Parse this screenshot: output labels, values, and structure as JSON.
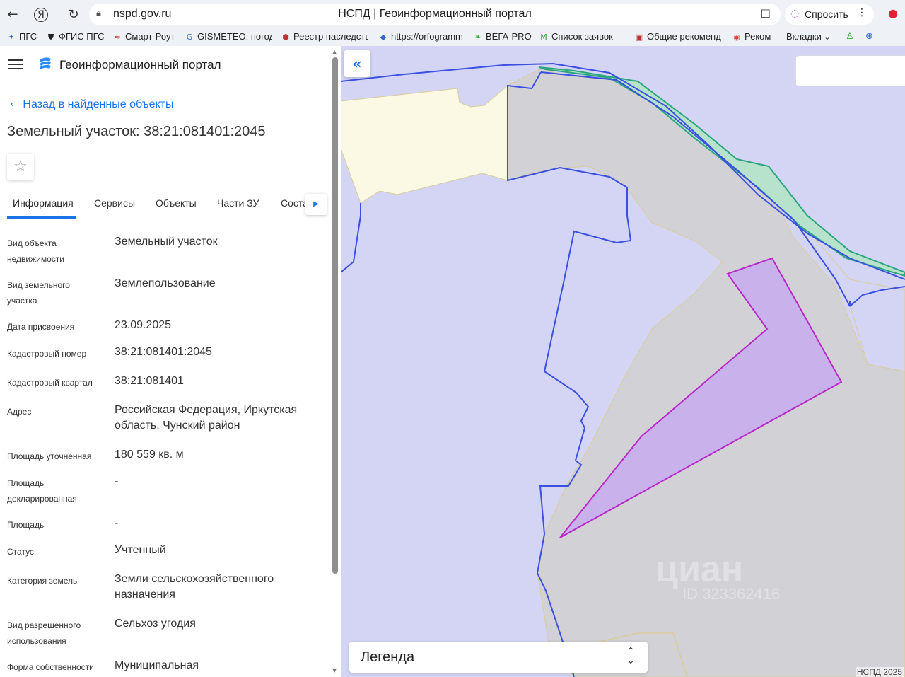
{
  "browser": {
    "url": "nspd.gov.ru",
    "tab_title": "НСПД | Геоинформационный портал",
    "ask_button": "Спросить",
    "bookmarks": [
      {
        "label": "ПГС",
        "icon": "eagle-icon"
      },
      {
        "label": "ФГИС ПГС",
        "icon": "shield-icon"
      },
      {
        "label": "Смарт-Роут",
        "icon": "route-icon"
      },
      {
        "label": "GISMETEO: погод",
        "icon": "gismeteo-icon"
      },
      {
        "label": "Реестр наследств",
        "icon": "registry-icon"
      },
      {
        "label": "https://orfogramm",
        "icon": "drop-icon"
      },
      {
        "label": "ВЕГА-PRO",
        "icon": "leaf-icon"
      },
      {
        "label": "Список заявок —",
        "icon": "gmail-icon"
      },
      {
        "label": "Общие рекоменд",
        "icon": "doc-icon"
      },
      {
        "label": "Реком",
        "icon": "circle-icon"
      },
      {
        "label": "Вкладки",
        "icon": "chevron-down-icon"
      }
    ]
  },
  "panel": {
    "portal_title": "Геоинформационный портал",
    "back_link": "Назад в найденные объекты",
    "object_title": "Земельный участок: 38:21:081401:2045",
    "tabs": [
      {
        "label": "Информация",
        "active": true
      },
      {
        "label": "Сервисы"
      },
      {
        "label": "Объекты"
      },
      {
        "label": "Части ЗУ"
      },
      {
        "label": "Соста"
      }
    ],
    "fields": [
      {
        "label": "Вид объекта недвижимости",
        "value": "Земельный участок"
      },
      {
        "label": "Вид земельного участка",
        "value": "Землепользование"
      },
      {
        "label": "Дата присвоения",
        "value": "23.09.2025"
      },
      {
        "label": "Кадастровый номер",
        "value": "38:21:081401:2045"
      },
      {
        "label": "Кадастровый квартал",
        "value": "38:21:081401"
      },
      {
        "label": "Адрес",
        "value": "Российская Федерация, Иркутская область, Чунский район"
      },
      {
        "label": "Площадь уточненная",
        "value": "180 559 кв. м"
      },
      {
        "label": "Площадь декларированная",
        "value": "-"
      },
      {
        "label": "Площадь",
        "value": "-"
      },
      {
        "label": "Статус",
        "value": "Учтенный"
      },
      {
        "label": "Категория земель",
        "value": "Земли сельскохозяйственного назначения"
      },
      {
        "label": "Вид разрешенного использования",
        "value": "Сельхоз угодия"
      },
      {
        "label": "Форма собственности",
        "value": "Муниципальная"
      }
    ]
  },
  "map": {
    "legend_label": "Легенда",
    "watermark_brand": "циан",
    "watermark_id": "ID 323362416",
    "copyright": "НСПД 2025",
    "colors": {
      "background": "#d4d5f5",
      "gray_parcel": "#d2d2d6",
      "yellow_parcel": "#fbf8e4",
      "selected_fill": "#c9b1ec",
      "selected_stroke": "#b829c9",
      "blue_boundary": "#3b4fe0",
      "green_boundary": "#2aa57d"
    }
  }
}
